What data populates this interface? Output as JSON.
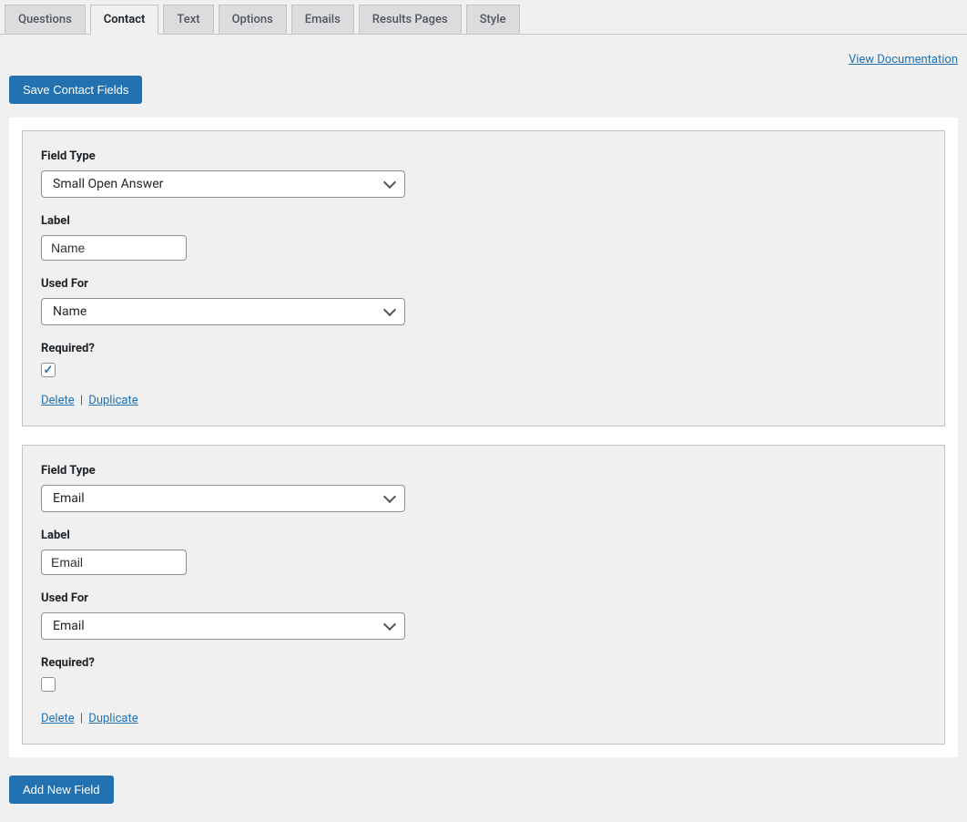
{
  "tabs": [
    {
      "label": "Questions",
      "active": false
    },
    {
      "label": "Contact",
      "active": true
    },
    {
      "label": "Text",
      "active": false
    },
    {
      "label": "Options",
      "active": false
    },
    {
      "label": "Emails",
      "active": false
    },
    {
      "label": "Results Pages",
      "active": false
    },
    {
      "label": "Style",
      "active": false
    }
  ],
  "doc_link": "View Documentation",
  "save_button": "Save Contact Fields",
  "add_button": "Add New Field",
  "labels": {
    "field_type": "Field Type",
    "label": "Label",
    "used_for": "Used For",
    "required": "Required?",
    "delete": "Delete",
    "duplicate": "Duplicate",
    "sep": "|"
  },
  "fields": [
    {
      "field_type": "Small Open Answer",
      "label_value": "Name",
      "used_for": "Name",
      "required": true
    },
    {
      "field_type": "Email",
      "label_value": "Email",
      "used_for": "Email",
      "required": false
    }
  ]
}
